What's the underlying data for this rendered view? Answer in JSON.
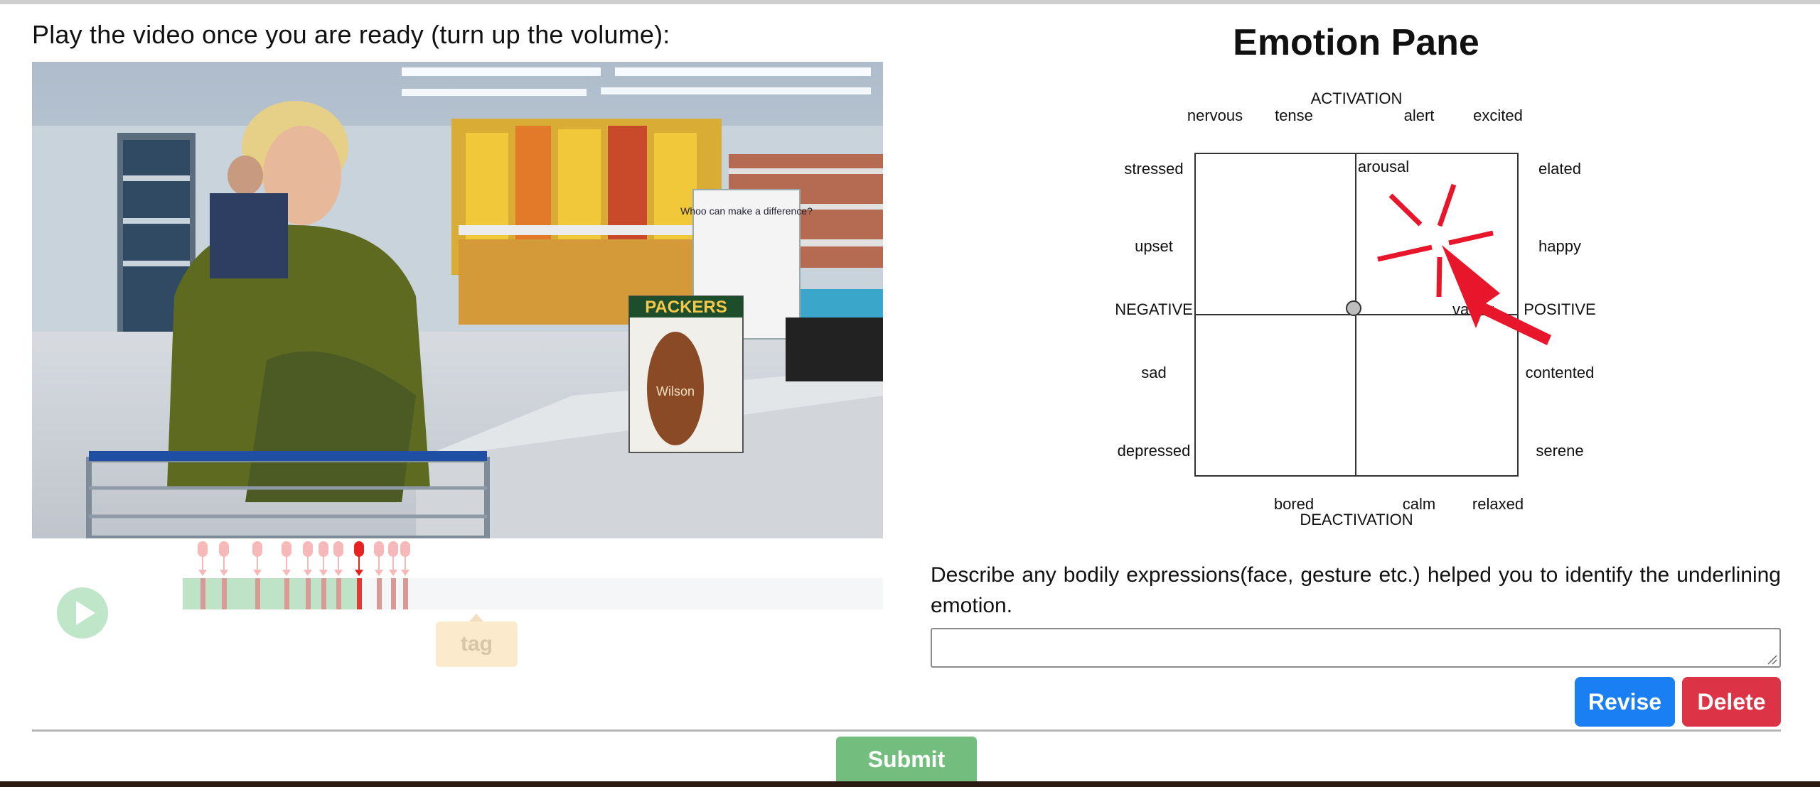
{
  "instruction": "Play the video once you are ready (turn up the volume):",
  "video": {
    "shelf_sign_text": "Whoo can make a difference?",
    "product_text": "PACKERS",
    "football_text": "Wilson"
  },
  "timeline": {
    "played_fraction": 0.255,
    "tag_label": "tag"
  },
  "emotion_pane": {
    "title": "Emotion Pane",
    "top_label": "ACTIVATION",
    "bottom_label": "DEACTIVATION",
    "left_label": "NEGATIVE",
    "right_label": "POSITIVE",
    "axis_arousal": "arousal",
    "axis_valence": "valence",
    "top_words": [
      "nervous",
      "tense",
      "alert",
      "excited"
    ],
    "bottom_words": [
      "bored",
      "calm",
      "relaxed"
    ],
    "left_words": [
      "stressed",
      "upset",
      "sad",
      "depressed"
    ],
    "right_words": [
      "elated",
      "happy",
      "contented",
      "serene"
    ],
    "click_color": "#e8162b"
  },
  "description": {
    "prompt": "Describe any bodily expressions(face, gesture etc.) helped you to identify the underlining emotion.",
    "value": ""
  },
  "buttons": {
    "revise": "Revise",
    "delete": "Delete",
    "submit": "Submit"
  },
  "colors": {
    "revise": "#1a7ff2",
    "delete": "#dc3446",
    "submit": "#73be7e",
    "timeline_played": "#bfe3c6",
    "tag_active": "#e82422"
  }
}
